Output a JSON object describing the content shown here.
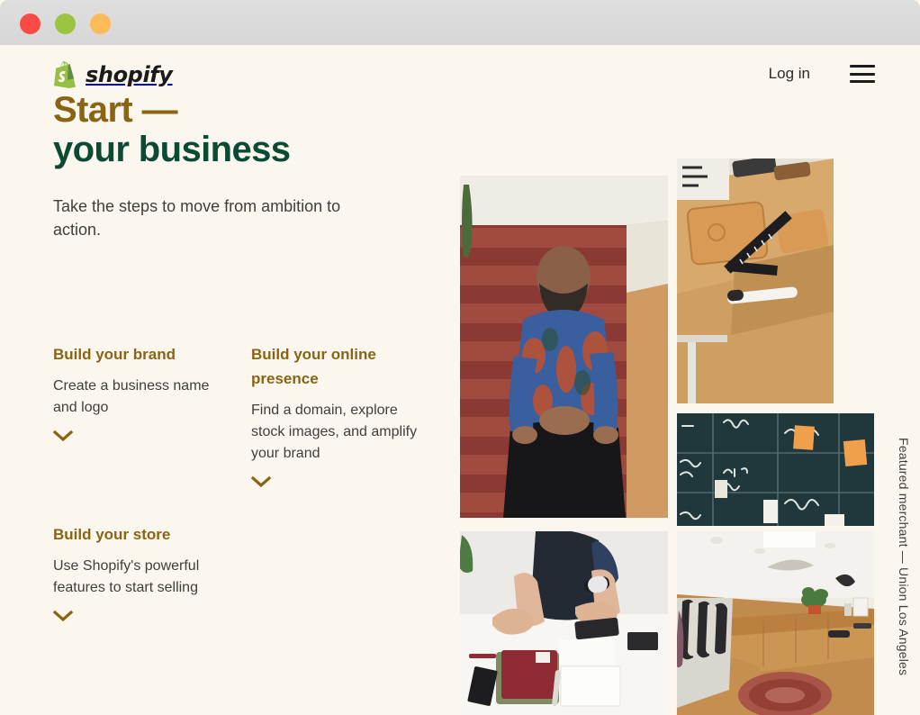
{
  "window": {
    "traffic_lights": [
      {
        "name": "close",
        "color": "#fb4b44"
      },
      {
        "name": "minimize",
        "color": "#9dc342"
      },
      {
        "name": "zoom",
        "color": "#fcbb58"
      }
    ]
  },
  "theme": {
    "background": "#fbf7ee",
    "gold": "#8a6414",
    "green": "#0b4a33",
    "body_text": "#3f3f3a",
    "logo_green": "#95bf47"
  },
  "header": {
    "brand": "shopify",
    "brand_icon": "shopify-bag-logo",
    "login_label": "Log in",
    "menu_icon": "hamburger-menu-icon"
  },
  "hero": {
    "title_line1": "Start —",
    "title_line2": "your business",
    "lede": "Take the steps to move from ambition to action."
  },
  "features": [
    {
      "title": "Build your brand",
      "description": "Create a business name and logo",
      "expand_icon": "chevron-down-icon"
    },
    {
      "title": "Build your online presence",
      "description": "Find a domain, explore stock images, and amplify your brand",
      "expand_icon": "chevron-down-icon"
    },
    {
      "title": "Build your store",
      "description": "Use Shopify's powerful features to start selling",
      "expand_icon": "chevron-down-icon"
    }
  ],
  "gallery": [
    {
      "name": "photo-merchant-portrait",
      "alt": "Merchant seated on red stairs wearing a blue floral shirt"
    },
    {
      "name": "photo-leather-workbench",
      "alt": "Leather goods, carpenter square and marker on a wooden workbench"
    },
    {
      "name": "photo-strategy-blackboard",
      "alt": "Blackboard planning grid with orange sticky notes labelled social"
    },
    {
      "name": "photo-desk-notebooks",
      "alt": "Person arranging notebooks and a phone on a white desk"
    },
    {
      "name": "photo-retail-store",
      "alt": "Interior of a retail clothing store with wooden counter and rug"
    }
  ],
  "caption": {
    "featured_merchant": "Featured merchant — Union Los Angeles"
  }
}
